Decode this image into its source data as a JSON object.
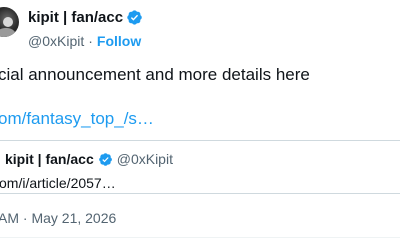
{
  "author": {
    "display_name": "kipit | fan/acc",
    "handle": "@0xKipit",
    "separator": "·",
    "follow_label": "Follow",
    "verified_icon": "verified-badge-icon"
  },
  "tweet": {
    "text": "cial announcement and more details here",
    "link": "om/fantasy_top_/s…"
  },
  "quote": {
    "display_name": "kipit | fan/acc",
    "handle": "@0xKipit",
    "link": "om/i/article/2057…"
  },
  "footer": {
    "timestamp": "AM · May 21, 2026"
  },
  "colors": {
    "accent": "#1d9bf0",
    "text": "#0f1419",
    "muted": "#536471",
    "border": "#cfd9de"
  }
}
